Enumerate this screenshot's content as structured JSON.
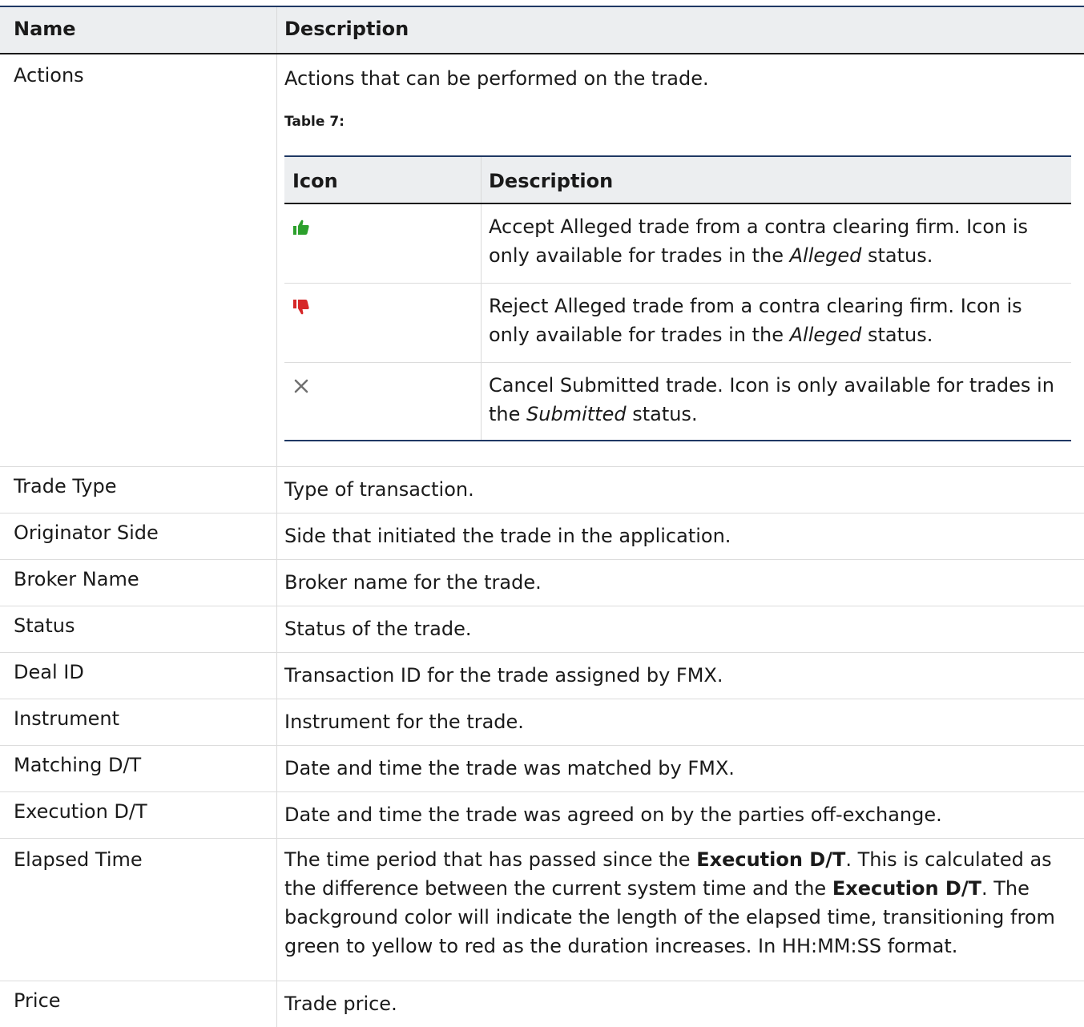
{
  "header": {
    "col_name": "Name",
    "col_description": "Description"
  },
  "actions": {
    "name": "Actions",
    "description": "Actions that can be performed on the trade.",
    "caption": "Table 7:",
    "inner_header": {
      "col_icon": "Icon",
      "col_description": "Description"
    },
    "icons": [
      {
        "icon": "thumbs-up-icon",
        "color": "#2ca02c",
        "text_before": "Accept Alleged trade from a contra clearing firm. Icon is only available for trades in the ",
        "emphasis": "Alleged",
        "text_after": " status."
      },
      {
        "icon": "thumbs-down-icon",
        "color": "#d62728",
        "text_before": "Reject Alleged trade from a contra clearing firm. Icon is only available for trades in the ",
        "emphasis": "Alleged",
        "text_after": " status."
      },
      {
        "icon": "close-icon",
        "color": "#707070",
        "text_before": "Cancel Submitted trade. Icon is only available for trades in the ",
        "emphasis": "Submitted",
        "text_after": " status."
      }
    ]
  },
  "rows": [
    {
      "name": "Trade Type",
      "description": "Type of transaction."
    },
    {
      "name": "Originator Side",
      "description": "Side that initiated the trade in the application."
    },
    {
      "name": "Broker Name",
      "description": "Broker name for the trade."
    },
    {
      "name": "Status",
      "description": "Status of the trade."
    },
    {
      "name": "Deal ID",
      "description": "Transaction ID for the trade assigned by FMX."
    },
    {
      "name": "Instrument",
      "description": "Instrument for the trade."
    },
    {
      "name": "Matching D/T",
      "description": "Date and time the trade was matched by FMX."
    },
    {
      "name": "Execution D/T",
      "description": "Date and time the trade was agreed on by the parties off-exchange."
    }
  ],
  "elapsed": {
    "name": "Elapsed Time",
    "part1": "The time period that has passed since the ",
    "bold1": "Execution D/T",
    "part2": ". This is calculated as the difference between the current system time and the ",
    "bold2": "Execution D/T",
    "part3": ". The background color will indicate the length of the elapsed time, transitioning from green to yellow to red as the duration increases. In HH:MM:SS format."
  },
  "price": {
    "name": "Price",
    "description": "Trade price."
  }
}
